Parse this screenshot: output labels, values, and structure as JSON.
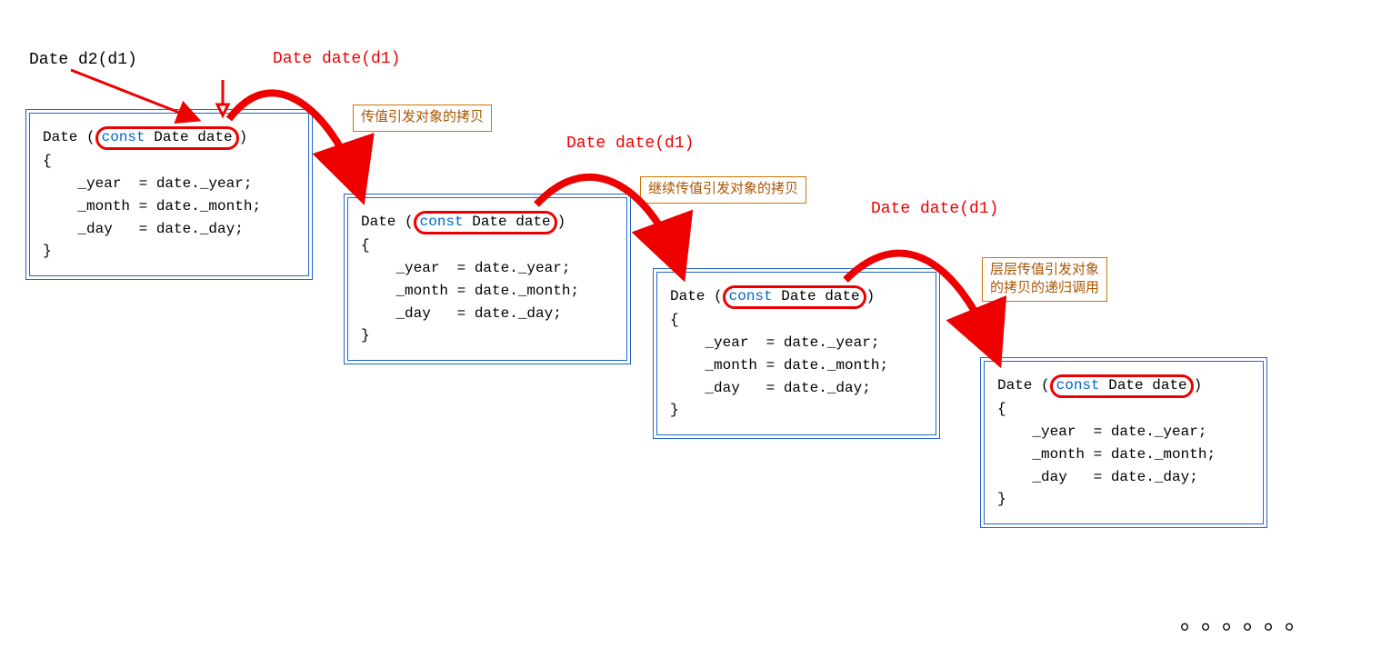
{
  "topDecl": "Date d2(d1)",
  "callLabels": [
    "Date date(d1)",
    "Date date(d1)",
    "Date date(d1)",
    "Date date(d1)"
  ],
  "annots": {
    "a1": "传值引发对象的拷贝",
    "a2": "继续传值引发对象的拷贝",
    "a3": "层层传值引发对象\n的拷贝的递归调用"
  },
  "codeBlock": {
    "head_pre": "Date (",
    "kw": "const",
    "param_rest": " Date date",
    "head_post": ")",
    "body": "{\n    _year  = date._year;\n    _month = date._month;\n    _day   = date._day;\n}"
  },
  "dots": "。。。。。。"
}
